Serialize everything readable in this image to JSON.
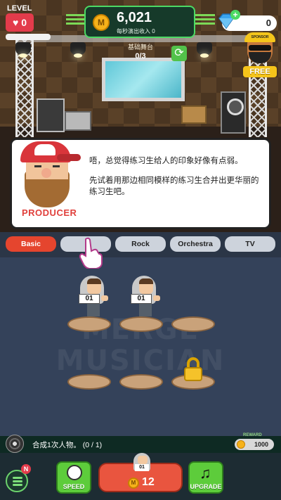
{
  "hud": {
    "level_label": "LEVEL",
    "hearts": "0",
    "coins": "6,021",
    "coin_symbol": "M",
    "rate_label": "每秒演出收入 0",
    "gems": "0",
    "gem_plus": "+",
    "stage_name": "基础舞台",
    "stage_count": "0/3",
    "sponsor_hat_text": "SPONSOR",
    "free_label": "FREE"
  },
  "dialog": {
    "speaker": "PRODUCER",
    "line1": "唔，总觉得练习生给人的印象好像有点弱。",
    "line2": "先试着用那边相同模样的练习生合并出更华丽的练习生吧。"
  },
  "tabs": [
    {
      "label": "Basic",
      "active": true
    },
    {
      "label": "",
      "active": false
    },
    {
      "label": "Rock",
      "active": false
    },
    {
      "label": "Orchestra",
      "active": false
    },
    {
      "label": "TV",
      "active": false
    }
  ],
  "board": {
    "watermark_line1": "MERGE",
    "watermark_line2": "MUSICIAN",
    "musicians": [
      {
        "badge": "01"
      },
      {
        "badge": "01"
      }
    ]
  },
  "mission": {
    "text": "合成1次人物。 (0 / 1)",
    "reward_label": "REWARD",
    "reward_value": "1000"
  },
  "bottom": {
    "notification_badge": "N",
    "speed_label": "SPEED",
    "upgrade_label": "UPGRADE",
    "buy_badge": "01",
    "buy_coin_symbol": "M",
    "buy_price": "12"
  },
  "colors": {
    "accent_green": "#4cd964",
    "tab_active": "#e5452e",
    "buy_button": "#e9553f",
    "heart_badge": "#e33b4b"
  }
}
